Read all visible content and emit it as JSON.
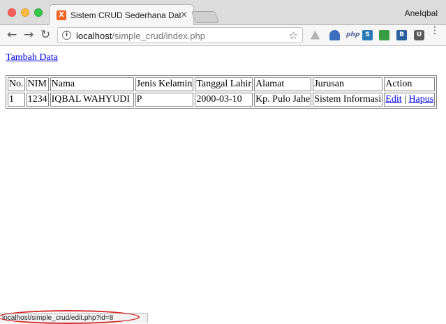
{
  "window": {
    "tab_title": "Sistem CRUD Sederhana Data",
    "tab_close": "×",
    "profile_name": "AneIqbal",
    "favicon_letter": "X"
  },
  "toolbar": {
    "back": "←",
    "forward": "→",
    "reload": "↻",
    "url_host": "localhost",
    "url_path": "/simple_crud/index.php",
    "star": "☆",
    "info": "i",
    "ext_php": "php",
    "ext_s": "S",
    "ext_b": "B",
    "ext_square": "U",
    "menu": "⋮"
  },
  "page": {
    "add_link": "Tambah Data",
    "table": {
      "headers": [
        "No.",
        "NIM",
        "Nama",
        "Jenis Kelamin",
        "Tanggal Lahir",
        "Alamat",
        "Jurusan",
        "Action"
      ],
      "rows": [
        {
          "no": "1",
          "nim": "1234",
          "nama": "IQBAL WAHYUDI",
          "jenis_kelamin": "P",
          "tanggal_lahir": "2000-03-10",
          "alamat": "Kp. Pulo Jahe",
          "jurusan": "Sistem Informasi",
          "edit_label": "Edit",
          "separator": "|",
          "hapus_label": "Hapus"
        }
      ]
    }
  },
  "status_bar": {
    "text": "localhost/simple_crud/edit.php?id=8"
  },
  "colors": {
    "link": "#0000ee",
    "annotation": "#d62a2a"
  }
}
